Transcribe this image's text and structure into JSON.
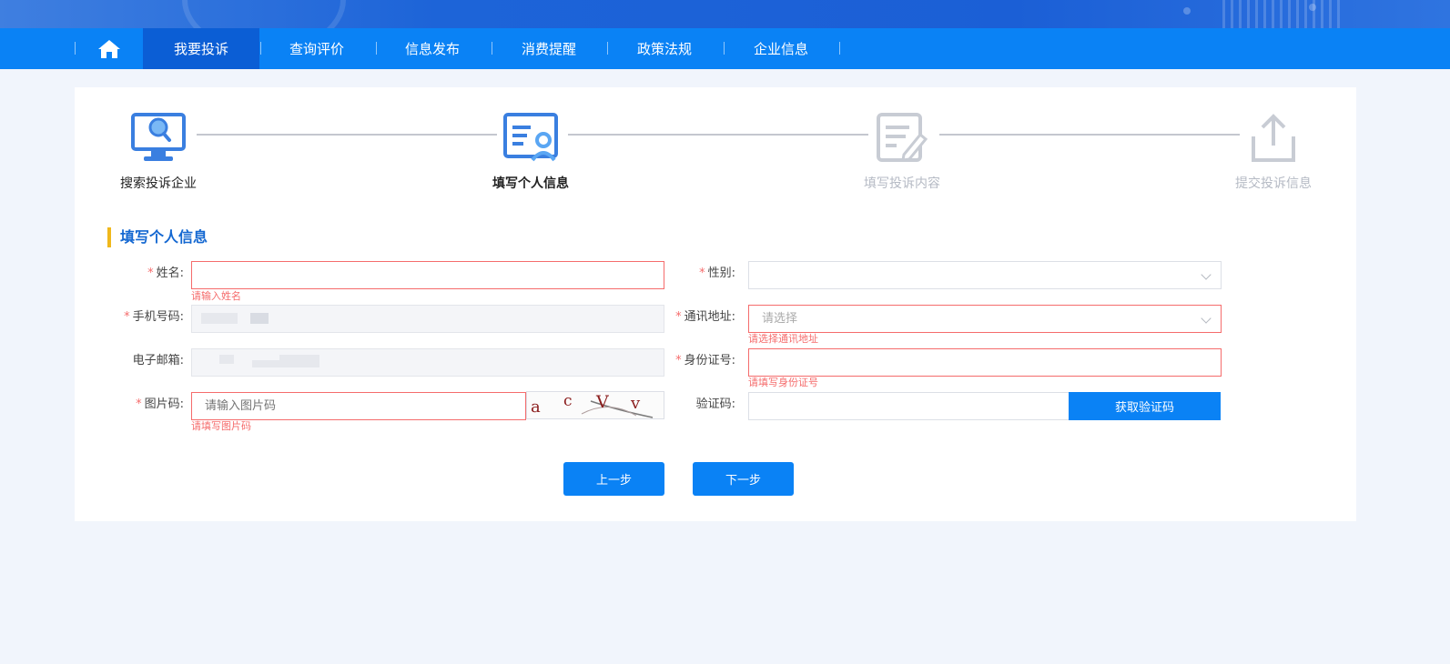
{
  "nav": {
    "items": [
      "我要投诉",
      "查询评价",
      "信息发布",
      "消费提醒",
      "政策法规",
      "企业信息"
    ],
    "active_index": 0
  },
  "steps": [
    {
      "label": "搜索投诉企业",
      "state": "done"
    },
    {
      "label": "填写个人信息",
      "state": "current"
    },
    {
      "label": "填写投诉内容",
      "state": "todo"
    },
    {
      "label": "提交投诉信息",
      "state": "todo"
    }
  ],
  "section_title": "填写个人信息",
  "form": {
    "name": {
      "label": "姓名:",
      "value": "",
      "error": "请输入姓名"
    },
    "gender": {
      "label": "性别:",
      "value": ""
    },
    "phone": {
      "label": "手机号码:"
    },
    "address": {
      "label": "通讯地址:",
      "placeholder": "请选择",
      "error": "请选择通讯地址"
    },
    "email": {
      "label": "电子邮箱:"
    },
    "id_number": {
      "label": "身份证号:",
      "value": "",
      "error": "请填写身份证号"
    },
    "captcha": {
      "label": "图片码:",
      "placeholder": "请输入图片码",
      "error": "请填写图片码",
      "image_text": "a c V v"
    },
    "sms_code": {
      "label": "验证码:",
      "button": "获取验证码"
    }
  },
  "buttons": {
    "prev": "上一步",
    "next": "下一步"
  },
  "colors": {
    "primary": "#0a82f5",
    "nav_active": "#0b5ed5",
    "error": "#f56c6c",
    "accent_bar": "#f0b81c",
    "step_icon": "#3a7fe0"
  }
}
